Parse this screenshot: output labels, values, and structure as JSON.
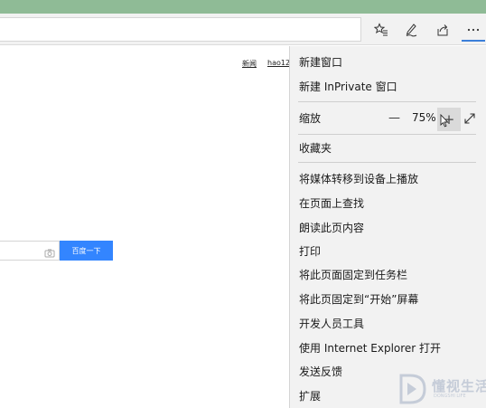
{
  "page": {
    "top_links": [
      "新闻",
      "hao12"
    ],
    "search_button_label": "百度一下"
  },
  "toolbar": {
    "icons": [
      "favorites-star-icon",
      "pen-note-icon",
      "share-icon",
      "more-icon"
    ]
  },
  "menu": {
    "new_window": "新建窗口",
    "new_inprivate": "新建 InPrivate 窗口",
    "zoom_label": "缩放",
    "zoom_minus": "—",
    "zoom_value": "75%",
    "zoom_plus": "+",
    "favorites": "收藏夹",
    "cast_media": "将媒体转移到设备上播放",
    "find_on_page": "在页面上查找",
    "read_aloud": "朗读此页内容",
    "print": "打印",
    "pin_taskbar": "将此页面固定到任务栏",
    "pin_start": "将此页固定到“开始”屏幕",
    "dev_tools": "开发人员工具",
    "open_ie": "使用 Internet Explorer 打开",
    "feedback": "发送反馈",
    "extensions": "扩展"
  },
  "watermark": {
    "text": "懂视生活",
    "sub": "DONGSHI LIFE"
  }
}
